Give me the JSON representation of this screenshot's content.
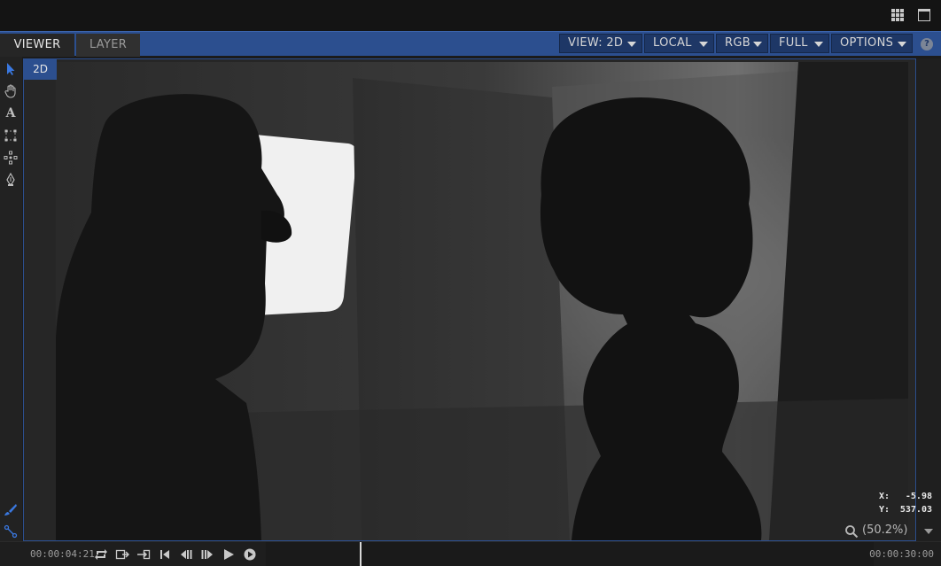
{
  "tabs": [
    {
      "label": "VIEWER",
      "active": true
    },
    {
      "label": "LAYER",
      "active": false
    }
  ],
  "viewer_menus": [
    {
      "label": "VIEW: 2D"
    },
    {
      "label": "LOCAL"
    },
    {
      "label": "RGB"
    },
    {
      "label": "FULL"
    },
    {
      "label": "OPTIONS"
    }
  ],
  "help_label": "?",
  "view_mode_badge": "2D",
  "tools": [
    "select-arrow-icon",
    "hand-pan-icon",
    "text-tool-icon",
    "transform-box-icon",
    "anchor-move-icon",
    "pen-tool-icon",
    "paint-brush-icon",
    "node-link-icon"
  ],
  "coords": {
    "x_label": "X:",
    "x_value": "-5.98",
    "y_label": "Y:",
    "y_value": "537.03"
  },
  "zoom": {
    "value": "(50.2%)"
  },
  "timeline": {
    "current": "00:00:04:21",
    "end": "00:00:30:00",
    "playhead_fraction": 0.162
  },
  "colors": {
    "accent": "#2c4f8f",
    "panel": "#262626",
    "titlebar": "#141414"
  }
}
